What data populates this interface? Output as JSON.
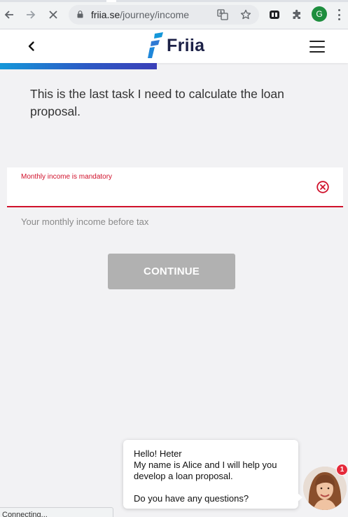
{
  "browser": {
    "url_host": "friia.se",
    "url_path": "/journey/income",
    "avatar_letter": "G"
  },
  "header": {
    "logo_text": "Friia",
    "brand_colors": {
      "navy": "#1c2147",
      "blue": "#1597d9",
      "indigo": "#3b3fb8"
    }
  },
  "progress": {
    "fraction": 0.45
  },
  "main": {
    "intro_text": "This is the last task I need to calculate the loan proposal.",
    "income_field": {
      "error_label": "Monthly income is mandatory",
      "value": "",
      "helper_text": "Your monthly income before tax"
    },
    "continue_label": "CONTINUE"
  },
  "chat": {
    "greeting": "Hello! Heter",
    "line2": "My name is Alice and I will help you develop a loan proposal.",
    "question": "Do you have any questions?",
    "badge_count": "1"
  },
  "status_text": "Connecting...",
  "colors": {
    "error": "#d0112b",
    "disabled_button": "#b1b1b1",
    "badge": "#e52b3b"
  }
}
